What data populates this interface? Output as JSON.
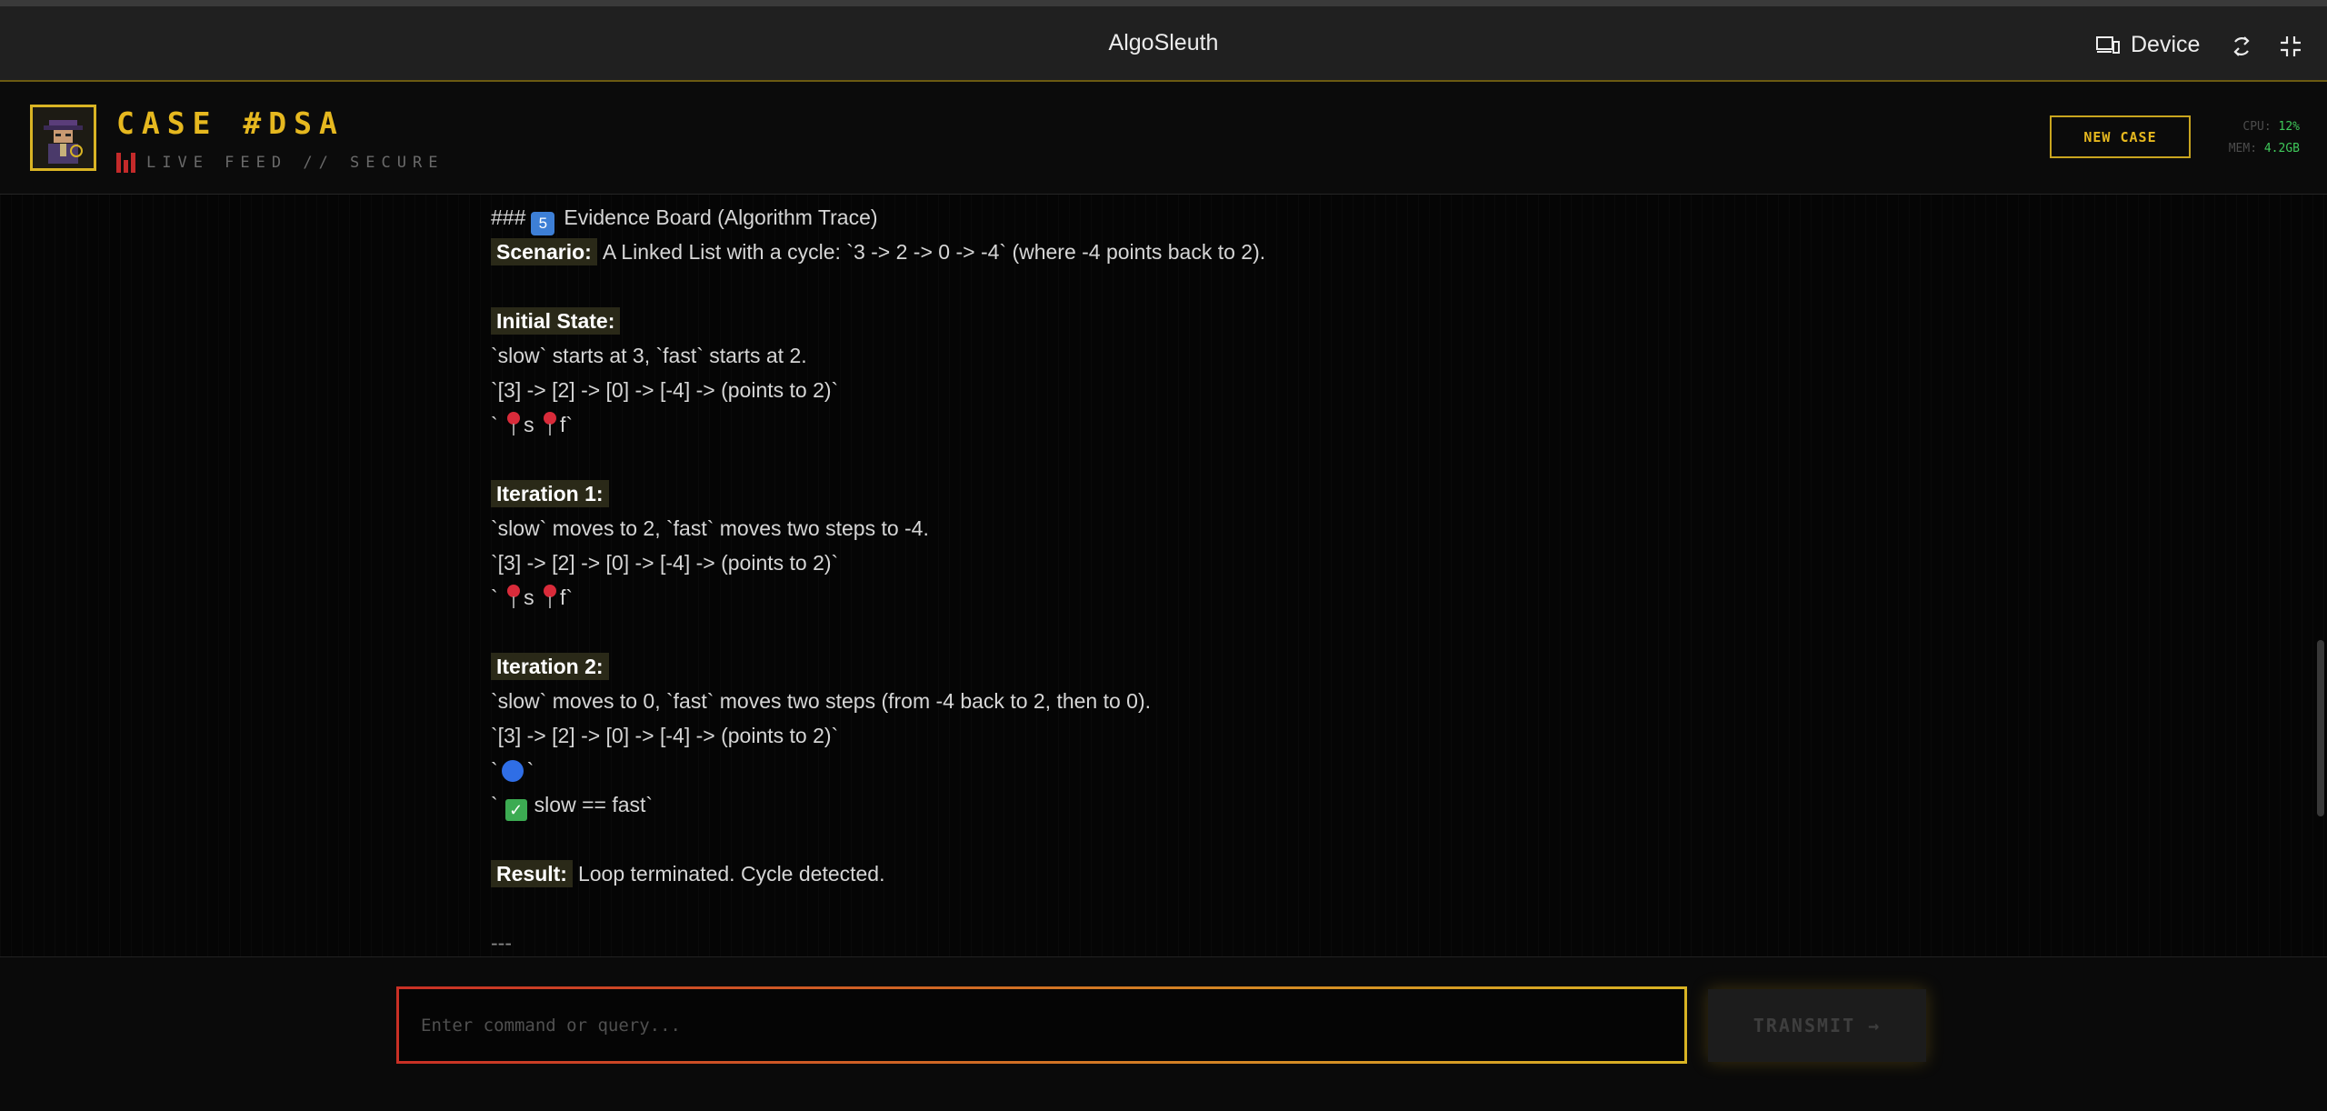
{
  "window": {
    "title": "AlgoSleuth",
    "device_label": "Device"
  },
  "header": {
    "case_title": "CASE #DSA",
    "feed_text": "LIVE FEED // SECURE",
    "new_case_label": "NEW CASE",
    "cpu_label": "CPU:",
    "cpu_value": "12%",
    "mem_label": "MEM:",
    "mem_value": "4.2GB"
  },
  "trace": {
    "heading_prefix": "###",
    "heading_number": "5",
    "heading_text": "Evidence Board (Algorithm Trace)",
    "scenario_label": "Scenario:",
    "scenario_text": "A Linked List with a cycle: `3 -> 2 -> 0 -> -4` (where -4 points back to 2).",
    "initial_label": "Initial State:",
    "initial_desc": "`slow` starts at 3, `fast` starts at 2.",
    "initial_list": "`[3] -> [2] -> [0] -> [-4] -> (points to 2)`",
    "initial_pointers_open": "`",
    "initial_s": "s",
    "initial_f": "f`",
    "iter1_label": "Iteration 1:",
    "iter1_desc": "`slow` moves to 2, `fast` moves two steps to -4.",
    "iter1_list": "`[3] -> [2] -> [0] -> [-4] -> (points to 2)`",
    "iter1_pointers_open": "`",
    "iter1_s": "s",
    "iter1_f": "f`",
    "iter2_label": "Iteration 2:",
    "iter2_desc": "`slow` moves to 0, `fast` moves two steps (from -4 back to 2, then to 0).",
    "iter2_list": "`[3] -> [2] -> [0] -> [-4] -> (points to 2)`",
    "iter2_dot_open": "`",
    "iter2_dot_close": "`",
    "iter2_check_open": "`",
    "iter2_check_text": "slow == fast`",
    "result_label": "Result:",
    "result_text": "Loop terminated. Cycle detected.",
    "separator": "---"
  },
  "input": {
    "placeholder": "Enter command or query...",
    "value": "",
    "transmit_label": "TRANSMIT →"
  },
  "colors": {
    "accent": "#e6b81f",
    "danger": "#c42a2a",
    "ok": "#3fc85a",
    "pin": "#d92b3a",
    "dot": "#2f6ee6"
  }
}
